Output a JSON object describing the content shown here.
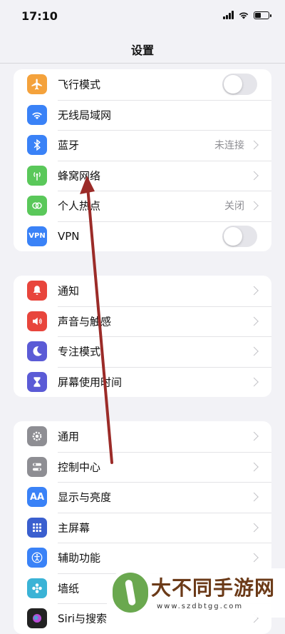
{
  "status_bar": {
    "time": "17:10",
    "battery_level": 0.45
  },
  "nav": {
    "title": "设置"
  },
  "groups": [
    {
      "rows": [
        {
          "label": "飞行模式",
          "icon": "airplane-icon",
          "color": "#f4a23c",
          "accessory": "toggle",
          "on": false
        },
        {
          "label": "无线局域网",
          "icon": "wifi-icon",
          "color": "#3a82f7",
          "accessory": "none"
        },
        {
          "label": "蓝牙",
          "icon": "bluetooth-icon",
          "color": "#3a82f7",
          "accessory": "chevron",
          "value": "未连接"
        },
        {
          "label": "蜂窝网络",
          "icon": "antenna-icon",
          "color": "#5ac85a",
          "accessory": "chevron"
        },
        {
          "label": "个人热点",
          "icon": "hotspot-icon",
          "color": "#5ac85a",
          "accessory": "chevron",
          "value": "关闭"
        },
        {
          "label": "VPN",
          "icon": "vpn-icon",
          "color": "#3a82f7",
          "accessory": "toggle",
          "on": false,
          "icon_text": "VPN"
        }
      ]
    },
    {
      "rows": [
        {
          "label": "通知",
          "icon": "bell-icon",
          "color": "#e8453c",
          "accessory": "chevron"
        },
        {
          "label": "声音与触感",
          "icon": "speaker-icon",
          "color": "#e8453c",
          "accessory": "chevron"
        },
        {
          "label": "专注模式",
          "icon": "moon-icon",
          "color": "#5b5bd6",
          "accessory": "chevron"
        },
        {
          "label": "屏幕使用时间",
          "icon": "hourglass-icon",
          "color": "#5b5bd6",
          "accessory": "chevron"
        }
      ]
    },
    {
      "rows": [
        {
          "label": "通用",
          "icon": "gear-icon",
          "color": "#8e8e93",
          "accessory": "chevron"
        },
        {
          "label": "控制中心",
          "icon": "switches-icon",
          "color": "#8e8e93",
          "accessory": "chevron"
        },
        {
          "label": "显示与亮度",
          "icon": "text-size-icon",
          "color": "#3a82f7",
          "accessory": "chevron",
          "icon_text": "AA"
        },
        {
          "label": "主屏幕",
          "icon": "home-grid-icon",
          "color": "#3a5fcf",
          "accessory": "chevron"
        },
        {
          "label": "辅助功能",
          "icon": "accessibility-icon",
          "color": "#3a82f7",
          "accessory": "chevron"
        },
        {
          "label": "墙纸",
          "icon": "wallpaper-icon",
          "color": "#3ab3d6",
          "accessory": "chevron"
        },
        {
          "label": "Siri与搜索",
          "icon": "siri-icon",
          "color": "#222222",
          "accessory": "chevron"
        }
      ]
    }
  ],
  "watermark": {
    "brand": "大不同手游网",
    "url": "www.szdbtgg.com"
  }
}
